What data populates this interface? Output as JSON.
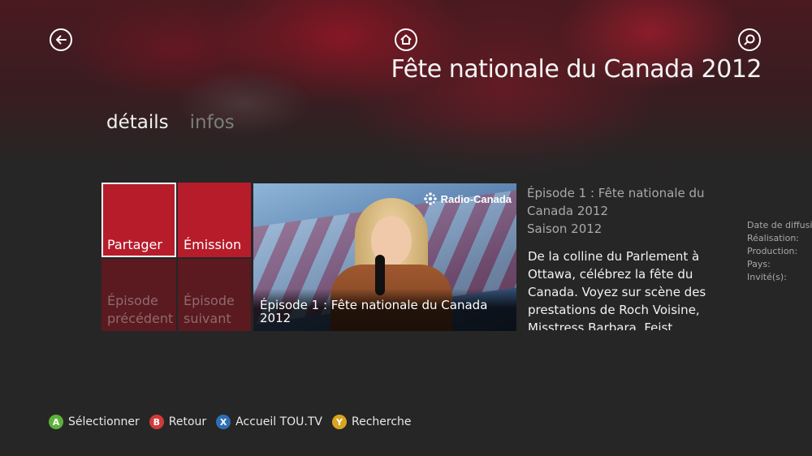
{
  "header": {
    "back_icon": "back-arrow-icon",
    "home_icon": "home-icon",
    "search_icon": "search-icon",
    "title": "Fête nationale du Canada 2012"
  },
  "tabs": [
    {
      "label": "détails",
      "active": true
    },
    {
      "label": "infos",
      "active": false
    }
  ],
  "tiles": {
    "share": "Partager",
    "show": "Émission",
    "prev": "Épisode précédent",
    "next": "Épisode suivant",
    "accent_color": "#b71c2b"
  },
  "video": {
    "brand": "Radio-Canada",
    "caption": "Épisode 1 : Fête nationale du Canada 2012"
  },
  "episode": {
    "title": "Épisode 1 : Fête nationale du Canada 2012",
    "season": "Saison 2012",
    "description": "De la colline du Parlement à Ottawa, célébrez la fête du Canada. Voyez sur scène des prestations de Roch Voisine, Misstress Barbara, Feist"
  },
  "meta": {
    "broadcast": "Date de diffusion:",
    "director": "Réalisation:",
    "production": "Production:",
    "country": "Pays:",
    "guests": "Invité(s):"
  },
  "footer": [
    {
      "key": "A",
      "label": "Sélectionner",
      "color": "#5db13a"
    },
    {
      "key": "B",
      "label": "Retour",
      "color": "#d23a3a"
    },
    {
      "key": "X",
      "label": "Accueil TOU.TV",
      "color": "#2f6fb3"
    },
    {
      "key": "Y",
      "label": "Recherche",
      "color": "#d9a420"
    }
  ]
}
